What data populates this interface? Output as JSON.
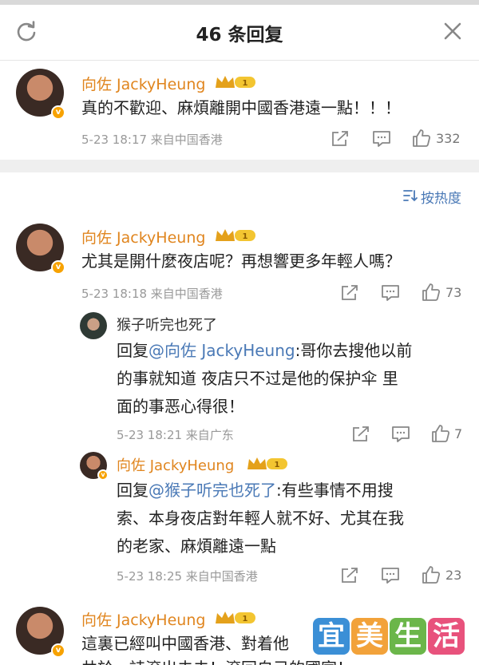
{
  "header": {
    "title": "46 条回复",
    "refresh_icon": "refresh-icon",
    "close_icon": "close-icon"
  },
  "sort": {
    "label": "按热度"
  },
  "level_badge": "1",
  "comments": [
    {
      "author": "向佐 JackyHeung",
      "text": "真的不歡迎、麻煩離開中國香港遠一點！！！",
      "meta": "5-23 18:17  来自中国香港",
      "likes": "332"
    },
    {
      "author": "向佐 JackyHeung",
      "text": "尤其是開什麼夜店呢？再想響更多年輕人嗎？",
      "meta": "5-23 18:18  来自中国香港",
      "likes": "73",
      "replies": [
        {
          "author": "猴子听完也死了",
          "prefix": "回复",
          "mention": "@向佐 JackyHeung",
          "line1": ":哥你去搜他以前",
          "line2": "的事就知道 夜店只不过是他的保护伞 里",
          "line3": "面的事恶心得很！",
          "meta": "5-23 18:21  来自广东",
          "likes": "7"
        },
        {
          "author": "向佐 JackyHeung",
          "prefix": "回复",
          "mention": "@猴子听完也死了",
          "line1": ":有些事情不用搜",
          "line2": "索、本身夜店對年輕人就不好、尤其在我",
          "line3": "的老家、麻煩離遠一點",
          "meta": "5-23 18:25  来自中国香港",
          "likes": "23"
        }
      ]
    },
    {
      "author": "向佐 JackyHeung",
      "text": "這裏已經叫中國香港、對着他",
      "text2": "共於、詩滾出去去！滾回自己的國家！"
    }
  ],
  "watermark": [
    "宜",
    "美",
    "生",
    "活"
  ],
  "colors": {
    "name": "#e0851e",
    "mention": "#4a79b6",
    "meta": "#999999",
    "watermark": [
      "#3b8fd6",
      "#f2a23a",
      "#6bb64a",
      "#e8527c"
    ]
  }
}
